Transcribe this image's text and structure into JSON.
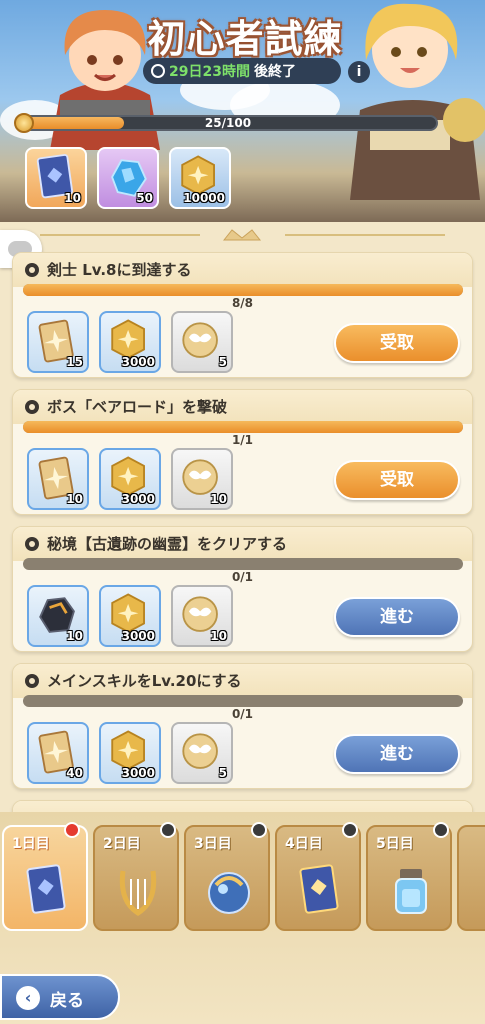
{
  "event": {
    "title": "初心者試練",
    "timer_highlight": "29日23時間",
    "timer_suffix": "後終了",
    "info_icon": "info-icon",
    "progress_text": "25/100",
    "progress_ratio": 0.25
  },
  "top_rewards": [
    {
      "icon": "card-icon",
      "count": "10"
    },
    {
      "icon": "crystal-icon",
      "count": "50"
    },
    {
      "icon": "gold-coin-icon",
      "count": "10000"
    }
  ],
  "quests": [
    {
      "title": "剣士 Lv.8に到達する",
      "progress": "8/8",
      "ratio": 1.0,
      "rewards": [
        {
          "icon": "golden-card-icon",
          "count": "15"
        },
        {
          "icon": "gold-coin-icon",
          "count": "3000"
        },
        {
          "icon": "winged-medal-icon",
          "count": "5"
        }
      ],
      "button": "受取",
      "button_style": "orange"
    },
    {
      "title": "ボス「ベアロード」を撃破",
      "progress": "1/1",
      "ratio": 1.0,
      "rewards": [
        {
          "icon": "golden-card-icon",
          "count": "10"
        },
        {
          "icon": "gold-coin-icon",
          "count": "3000"
        },
        {
          "icon": "winged-medal-icon",
          "count": "10"
        }
      ],
      "button": "受取",
      "button_style": "orange"
    },
    {
      "title": "秘境【古遺跡の幽霊】をクリアする",
      "progress": "0/1",
      "ratio": 0.0,
      "rewards": [
        {
          "icon": "dark-ore-icon",
          "count": "10"
        },
        {
          "icon": "gold-coin-icon",
          "count": "3000"
        },
        {
          "icon": "winged-medal-icon",
          "count": "10"
        }
      ],
      "button": "進む",
      "button_style": "blue"
    },
    {
      "title": "メインスキルをLv.20にする",
      "progress": "0/1",
      "ratio": 0.0,
      "rewards": [
        {
          "icon": "golden-card-icon",
          "count": "40"
        },
        {
          "icon": "gold-coin-icon",
          "count": "3000"
        },
        {
          "icon": "winged-medal-icon",
          "count": "5"
        }
      ],
      "button": "進む",
      "button_style": "blue"
    }
  ],
  "day_tabs": [
    {
      "label": "1日目",
      "icon": "card-icon",
      "active": true,
      "badge": true
    },
    {
      "label": "2日目",
      "icon": "lyre-icon",
      "locked": true
    },
    {
      "label": "3日目",
      "icon": "orb-icon",
      "locked": true
    },
    {
      "label": "4日目",
      "icon": "card-icon",
      "locked": true
    },
    {
      "label": "5日目",
      "icon": "potion-icon",
      "locked": true
    }
  ],
  "back_button": "戻る"
}
